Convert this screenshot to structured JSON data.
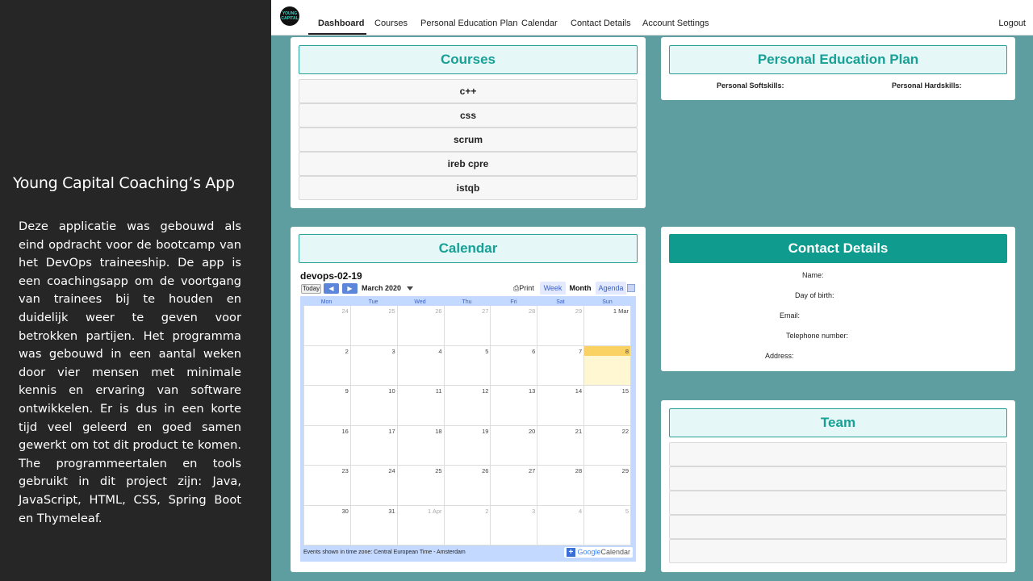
{
  "slide": {
    "title": "Young Capital Coaching’s App",
    "description": "Deze applicatie was gebouwd als eind opdracht voor de bootcamp van het DevOps traineeship. De app is een coachingsapp om de voortgang van trainees bij te houden en duidelijk weer te geven voor betrokken partijen. Het programma was gebouwd in een aantal weken door vier mensen met minimale kennis en ervaring van software ontwikkelen. Er is dus in een korte tijd veel geleerd en goed samen gewerkt om tot dit product te komen. The programmeertalen en tools gebruikt in dit project zijn: Java, JavaScript, HTML, CSS, Spring Boot en Thymeleaf."
  },
  "nav": {
    "logo_text": "YOUNG CAPITAL",
    "items": [
      "Dashboard",
      "Courses",
      "Personal Education Plan",
      "Calendar",
      "Contact Details",
      "Account Settings"
    ],
    "active": "Dashboard",
    "logout": "Logout"
  },
  "courses": {
    "title": "Courses",
    "items": [
      "c++",
      "css",
      "scrum",
      "ireb cpre",
      "istqb"
    ]
  },
  "pep": {
    "title": "Personal Education Plan",
    "softskills_label": "Personal Softskills:",
    "hardskills_label": "Personal Hardskills:"
  },
  "calendar": {
    "title": "Calendar",
    "cal_name": "devops-02-19",
    "today_label": "Today",
    "prev_icon": "◀",
    "next_icon": "▶",
    "month_label": "March 2020",
    "print_label": "Print",
    "views": [
      "Week",
      "Month",
      "Agenda"
    ],
    "selected_view": "Month",
    "day_headers": [
      "Mon",
      "Tue",
      "Wed",
      "Thu",
      "Fri",
      "Sat",
      "Sun"
    ],
    "weeks": [
      [
        "24",
        "25",
        "26",
        "27",
        "28",
        "29",
        "1 Mar"
      ],
      [
        "2",
        "3",
        "4",
        "5",
        "6",
        "7",
        "8"
      ],
      [
        "9",
        "10",
        "11",
        "12",
        "13",
        "14",
        "15"
      ],
      [
        "16",
        "17",
        "18",
        "19",
        "20",
        "21",
        "22"
      ],
      [
        "23",
        "24",
        "25",
        "26",
        "27",
        "28",
        "29"
      ],
      [
        "30",
        "31",
        "1 Apr",
        "2",
        "3",
        "4",
        "5"
      ]
    ],
    "today_date": "8",
    "timezone_note": "Events shown in time zone: Central European Time - Amsterdam",
    "google_plus": "+",
    "google_word": "Google",
    "calendar_word": "Calendar"
  },
  "contact": {
    "title": "Contact Details",
    "labels": [
      "Name:",
      "Day of birth:",
      "Email:",
      "Telephone number:",
      "Address:"
    ]
  },
  "team": {
    "title": "Team",
    "rows": [
      "",
      "",
      "",
      "",
      ""
    ]
  },
  "colors": {
    "app_background": "#5f9ea0",
    "accent": "#17a096",
    "header_filled": "#0f9b8e",
    "today_highlight": "#fad163"
  }
}
